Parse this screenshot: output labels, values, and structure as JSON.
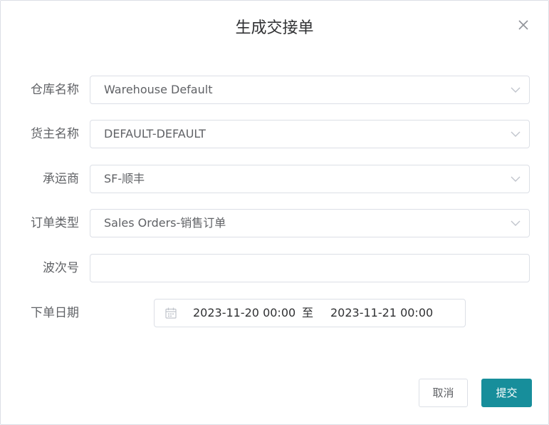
{
  "dialog": {
    "title": "生成交接单",
    "close_icon": "close-icon"
  },
  "form": {
    "warehouse": {
      "label": "仓库名称",
      "value": "Warehouse Default"
    },
    "owner": {
      "label": "货主名称",
      "value": "DEFAULT-DEFAULT"
    },
    "carrier": {
      "label": "承运商",
      "value": "SF-顺丰"
    },
    "order_type": {
      "label": "订单类型",
      "value": "Sales Orders-销售订单"
    },
    "wave_no": {
      "label": "波次号",
      "value": ""
    },
    "order_date": {
      "label": "下单日期",
      "start": "2023-11-20 00:00",
      "separator": "至",
      "end": "2023-11-21 00:00",
      "icon": "calendar-icon"
    }
  },
  "footer": {
    "cancel_label": "取消",
    "submit_label": "提交"
  },
  "colors": {
    "primary": "#178e9b",
    "border": "#dcdfe6",
    "text": "#606266"
  }
}
